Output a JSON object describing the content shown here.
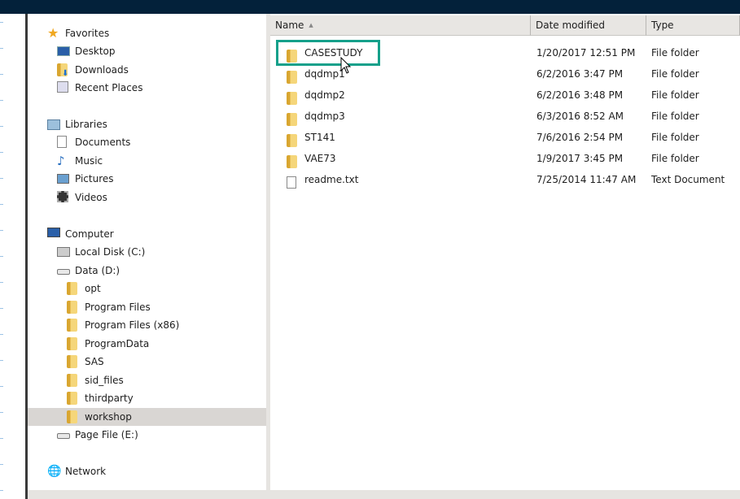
{
  "nav": {
    "favorites": {
      "label": "Favorites",
      "items": [
        {
          "label": "Desktop",
          "icon": "desktop-icon"
        },
        {
          "label": "Downloads",
          "icon": "downloads-icon"
        },
        {
          "label": "Recent Places",
          "icon": "recent-places-icon"
        }
      ]
    },
    "libraries": {
      "label": "Libraries",
      "items": [
        {
          "label": "Documents",
          "icon": "documents-icon"
        },
        {
          "label": "Music",
          "icon": "music-icon"
        },
        {
          "label": "Pictures",
          "icon": "pictures-icon"
        },
        {
          "label": "Videos",
          "icon": "videos-icon"
        }
      ]
    },
    "computer": {
      "label": "Computer",
      "drives": [
        {
          "label": "Local Disk (C:)"
        },
        {
          "label": "Data (D:)"
        },
        {
          "label": "Page File (E:)"
        }
      ],
      "data_folders": [
        "opt",
        "Program Files",
        "Program Files (x86)",
        "ProgramData",
        "SAS",
        "sid_files",
        "thirdparty",
        "workshop"
      ],
      "selected": "workshop"
    },
    "network": {
      "label": "Network"
    }
  },
  "columns": {
    "name": "Name",
    "sort_indicator": "▲",
    "date": "Date modified",
    "type": "Type"
  },
  "files": [
    {
      "name": "CASESTUDY",
      "date": "1/20/2017 12:51 PM",
      "type": "File folder",
      "icon": "folder-icon"
    },
    {
      "name": "dqdmp1",
      "date": "6/2/2016 3:47 PM",
      "type": "File folder",
      "icon": "folder-icon"
    },
    {
      "name": "dqdmp2",
      "date": "6/2/2016 3:48 PM",
      "type": "File folder",
      "icon": "folder-icon"
    },
    {
      "name": "dqdmp3",
      "date": "6/3/2016 8:52 AM",
      "type": "File folder",
      "icon": "folder-icon"
    },
    {
      "name": "ST141",
      "date": "7/6/2016 2:54 PM",
      "type": "File folder",
      "icon": "folder-icon"
    },
    {
      "name": "VAE73",
      "date": "1/9/2017 3:45 PM",
      "type": "File folder",
      "icon": "folder-icon"
    },
    {
      "name": "readme.txt",
      "date": "7/25/2014 11:47 AM",
      "type": "Text Document",
      "icon": "text-file-icon"
    }
  ],
  "highlight_color": "#15a08a"
}
